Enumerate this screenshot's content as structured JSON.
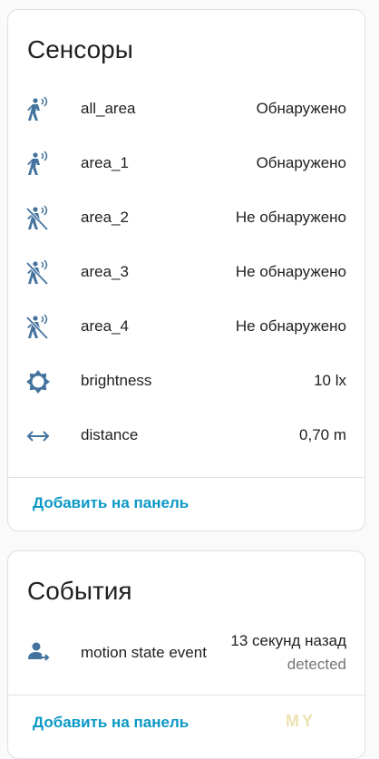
{
  "sensors": {
    "title": "Сенсоры",
    "rows": [
      {
        "icon": "motion-sensor-icon",
        "name": "all_area",
        "value": "Обнаружено"
      },
      {
        "icon": "motion-sensor-icon",
        "name": "area_1",
        "value": "Обнаружено"
      },
      {
        "icon": "motion-sensor-off-icon",
        "name": "area_2",
        "value": "Не обнаружено"
      },
      {
        "icon": "motion-sensor-off-icon",
        "name": "area_3",
        "value": "Не обнаружено"
      },
      {
        "icon": "motion-sensor-off-icon",
        "name": "area_4",
        "value": "Не обнаружено"
      },
      {
        "icon": "brightness-icon",
        "name": "brightness",
        "value": "10 lx"
      },
      {
        "icon": "arrow-left-right-icon",
        "name": "distance",
        "value": "0,70 m"
      }
    ],
    "action_label": "Добавить на панель"
  },
  "events": {
    "title": "События",
    "rows": [
      {
        "icon": "account-arrow-right-icon",
        "name": "motion state event",
        "time": "13 секунд назад",
        "state": "detected"
      }
    ],
    "action_label": "Добавить на панель"
  },
  "colors": {
    "icon": "#44739e",
    "accent": "#0a98c6",
    "watermark": "#e8dca0"
  },
  "watermark_text": "MY"
}
